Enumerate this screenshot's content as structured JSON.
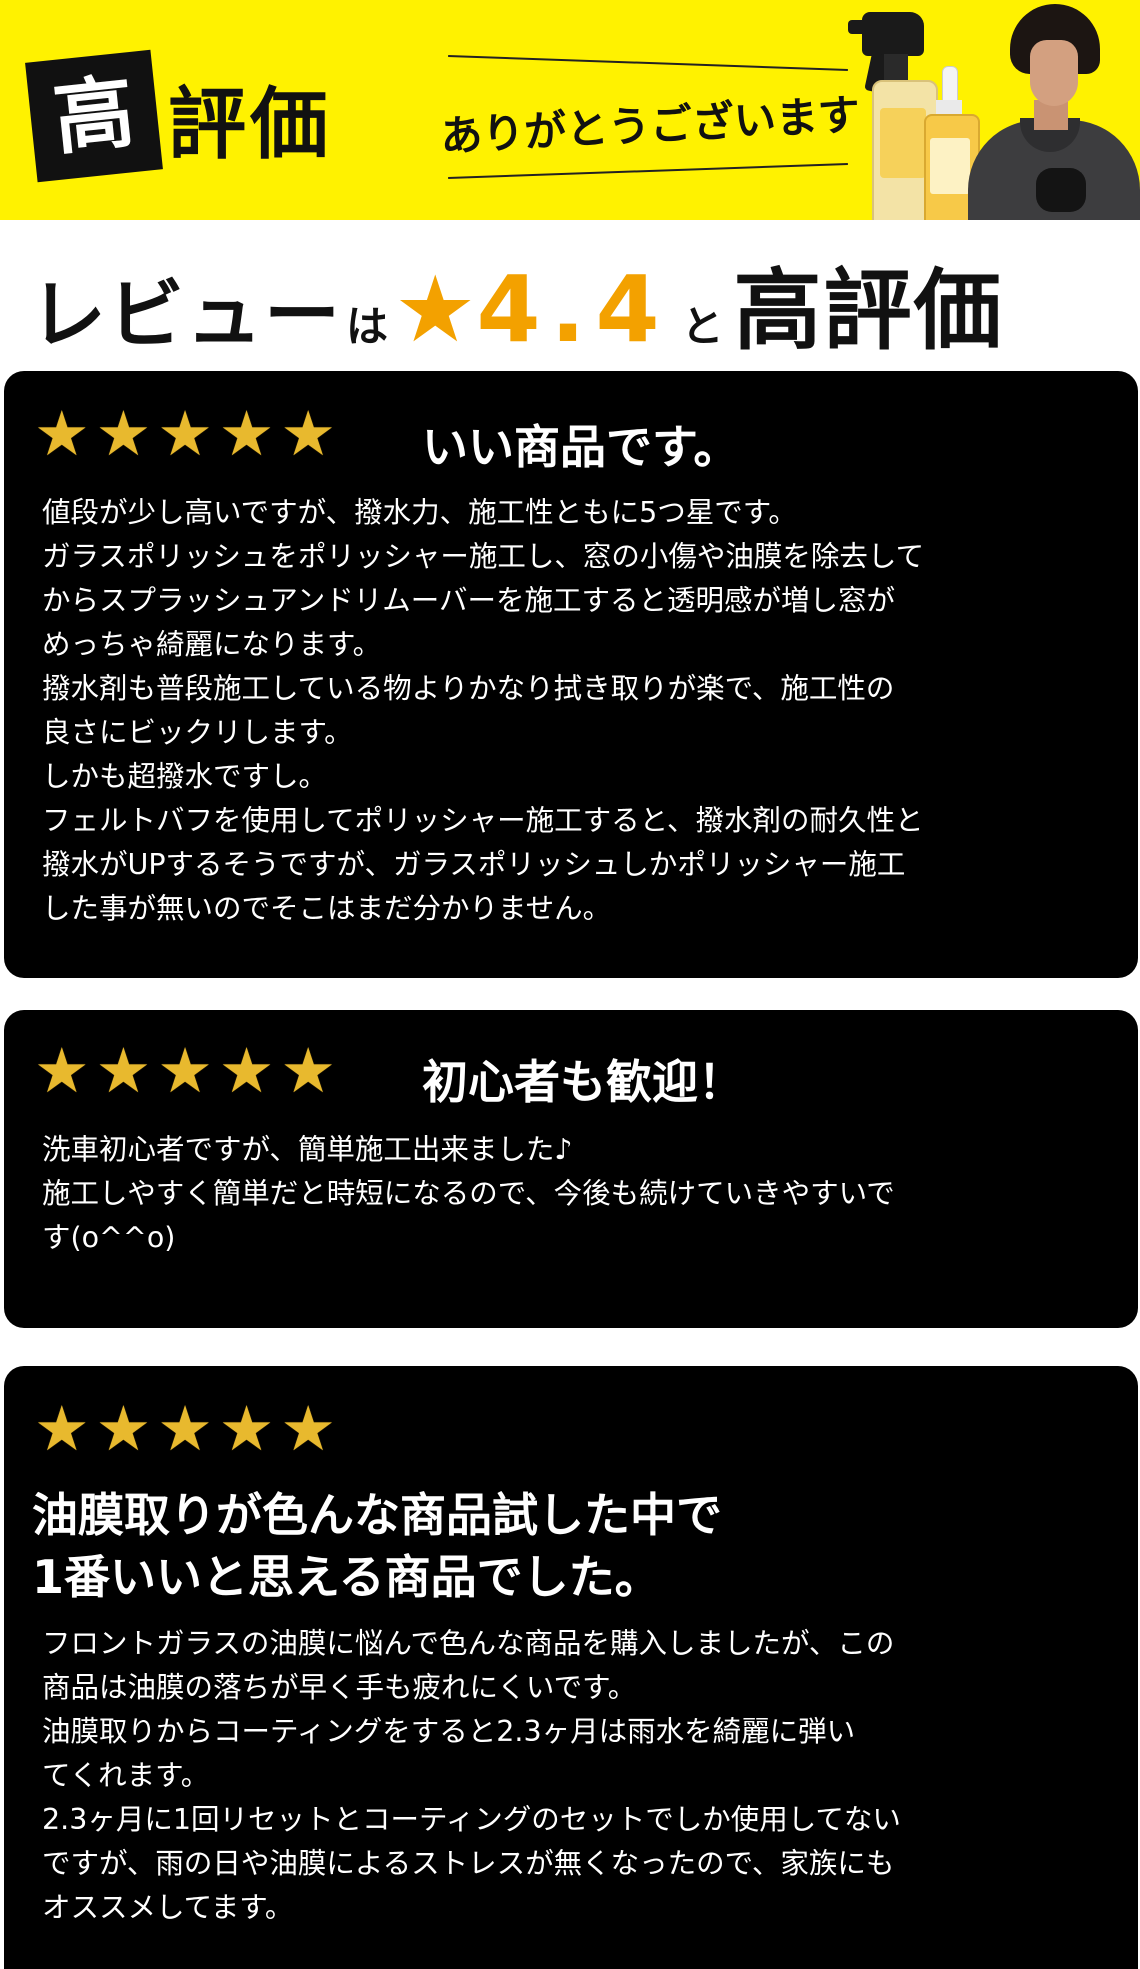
{
  "banner": {
    "badge_char": "高",
    "badge_rest": "評価",
    "thanks": "ありがとうございます"
  },
  "headline": {
    "review": "レビュー",
    "wa": "は",
    "star": "★",
    "rating": "4.4",
    "to": "と",
    "high": "高評価"
  },
  "colors": {
    "banner_bg": "#fff200",
    "accent_orange": "#f3a100",
    "star_gold": "#e8b92e",
    "card_bg": "#000000"
  },
  "reviews": [
    {
      "stars": 5,
      "title": "いい商品です。",
      "lines": [
        "値段が少し高いですが、撥水力、施工性ともに5つ星です。",
        "ガラスポリッシュをポリッシャー施工し、窓の小傷や油膜を除去して",
        "からスプラッシュアンドリムーバーを施工すると透明感が増し窓が",
        "めっちゃ綺麗になります。",
        "撥水剤も普段施工している物よりかなり拭き取りが楽で、施工性の",
        "良さにビックリします。",
        "しかも超撥水ですし。",
        "フェルトバフを使用してポリッシャー施工すると、撥水剤の耐久性と",
        "撥水がUPするそうですが、ガラスポリッシュしかポリッシャー施工",
        "した事が無いのでそこはまだ分かりません。"
      ]
    },
    {
      "stars": 5,
      "title": "初心者も歓迎！",
      "lines": [
        "洗車初心者ですが、簡単施工出来ました♪",
        "施工しやすく簡単だと時短になるので、今後も続けていきやすいで",
        "す(o^^o)"
      ]
    },
    {
      "stars": 5,
      "title_lines": [
        "油膜取りが色んな商品試した中で",
        "1番いいと思える商品でした。"
      ],
      "lines": [
        "フロントガラスの油膜に悩んで色んな商品を購入しましたが、この",
        "商品は油膜の落ちが早く手も疲れにくいです。",
        "油膜取りからコーティングをすると2.3ヶ月は雨水を綺麗に弾い",
        "てくれます。",
        "2.3ヶ月に1回リセットとコーティングのセットでしか使用してない",
        "ですが、雨の日や油膜によるストレスが無くなったので、家族にも",
        "オススメしてます。"
      ]
    }
  ]
}
